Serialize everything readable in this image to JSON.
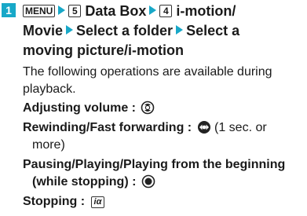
{
  "step": {
    "number": "1",
    "keys": {
      "menu": "MENU",
      "key5": "5",
      "item5": "Data Box",
      "key4": "4",
      "item4": "i-motion/",
      "line2a": "Movie",
      "line2b": "Select a folder",
      "line2c": "Select a",
      "line3": "moving picture/i-motion"
    }
  },
  "intro": [
    "The following operations are available during",
    "playback."
  ],
  "operations": [
    {
      "label": "Adjusting volume",
      "sep": " : ",
      "icon": "up-down-navigation-icon",
      "note": ""
    },
    {
      "label": "Rewinding/Fast forwarding",
      "sep": " : ",
      "icon": "left-right-navigation-icon",
      "note": " (1 sec. or",
      "note2": "more)"
    },
    {
      "label": "Pausing/Playing/Playing from the beginning",
      "label2": "(while stopping)",
      "sep": " : ",
      "icon": "center-key-icon"
    },
    {
      "label": "Stopping",
      "sep": " : ",
      "icon": "i-alpha-key-icon",
      "key_text": "iα"
    }
  ],
  "colors": {
    "accent": "#18a8c8",
    "text": "#1a1a1a"
  }
}
